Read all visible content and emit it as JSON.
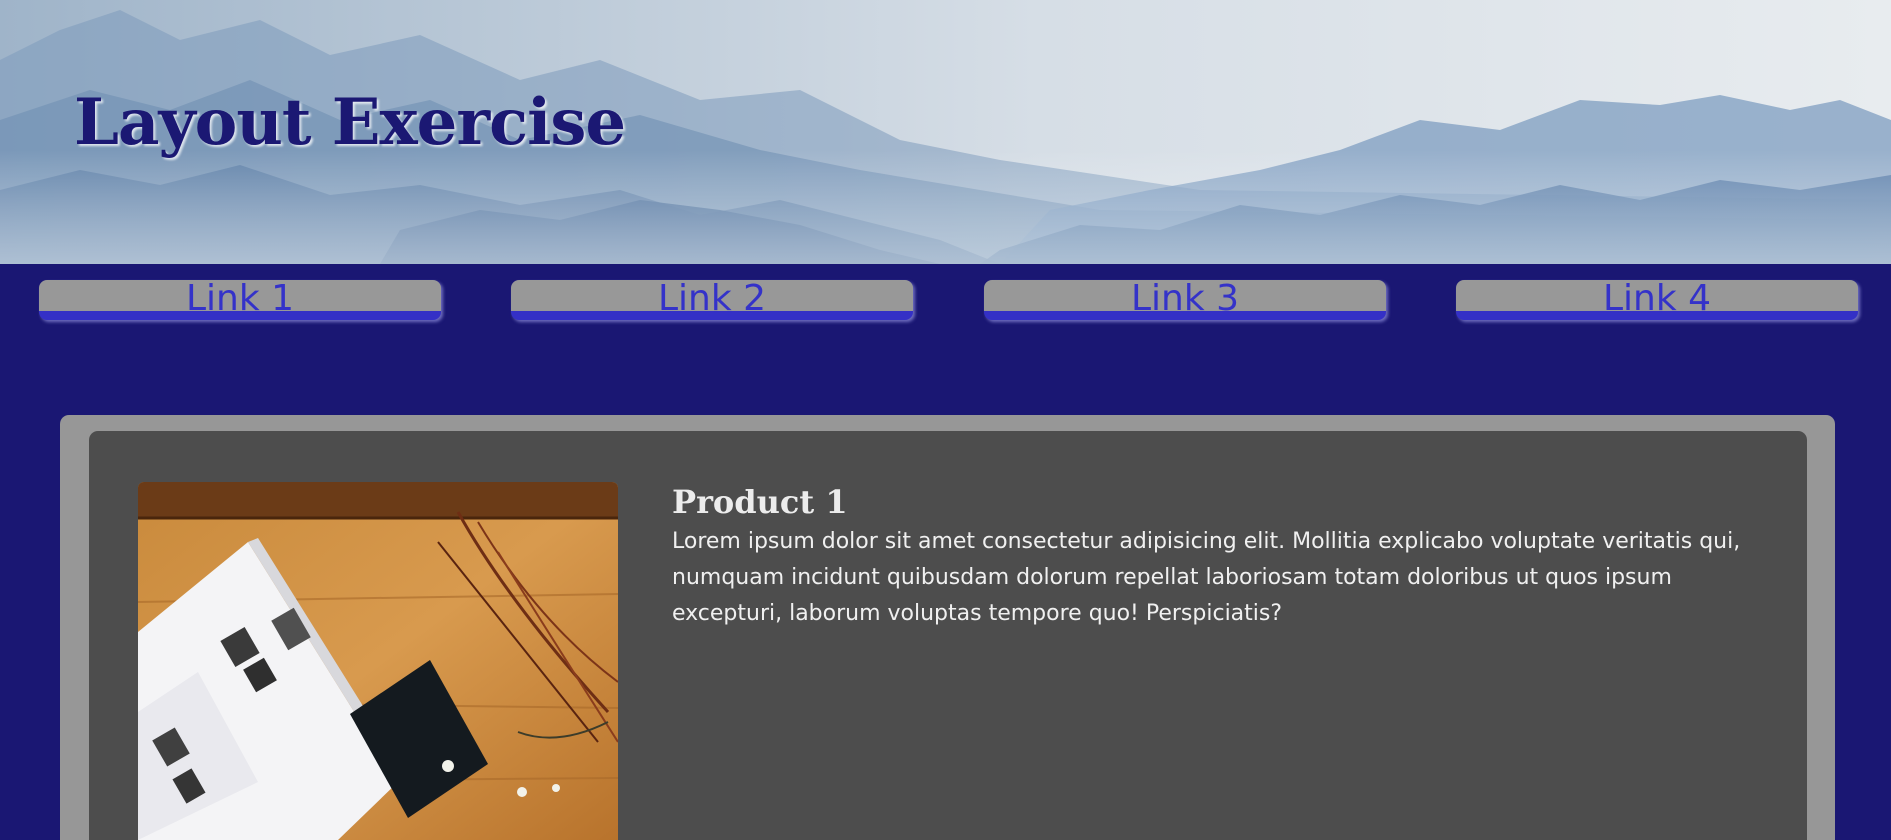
{
  "header": {
    "title": "Layout Exercise",
    "background": "mountain-landscape-image"
  },
  "nav": {
    "links": [
      {
        "label": "Link 1"
      },
      {
        "label": "Link 2"
      },
      {
        "label": "Link 3"
      },
      {
        "label": "Link 4"
      }
    ]
  },
  "product": {
    "title": "Product 1",
    "description": "Lorem ipsum dolor sit amet consectetur adipisicing elit. Mollitia explicabo voluptate veritatis qui, numquam incidunt quibusdam dolorum repellat laboriosam totam doloribus ut quos ipsum excepturi, laborum voluptas tempore quo! Perspiciatis?",
    "image": "open-magazine-on-wooden-table-photo"
  },
  "colors": {
    "page_background": "#1a1773",
    "link_text": "#3432c9",
    "link_background": "#989898",
    "link_underline": "#3430c6",
    "panel_outer": "#979797",
    "panel_inner": "#4d4d4d",
    "title_text": "#1b1873"
  }
}
